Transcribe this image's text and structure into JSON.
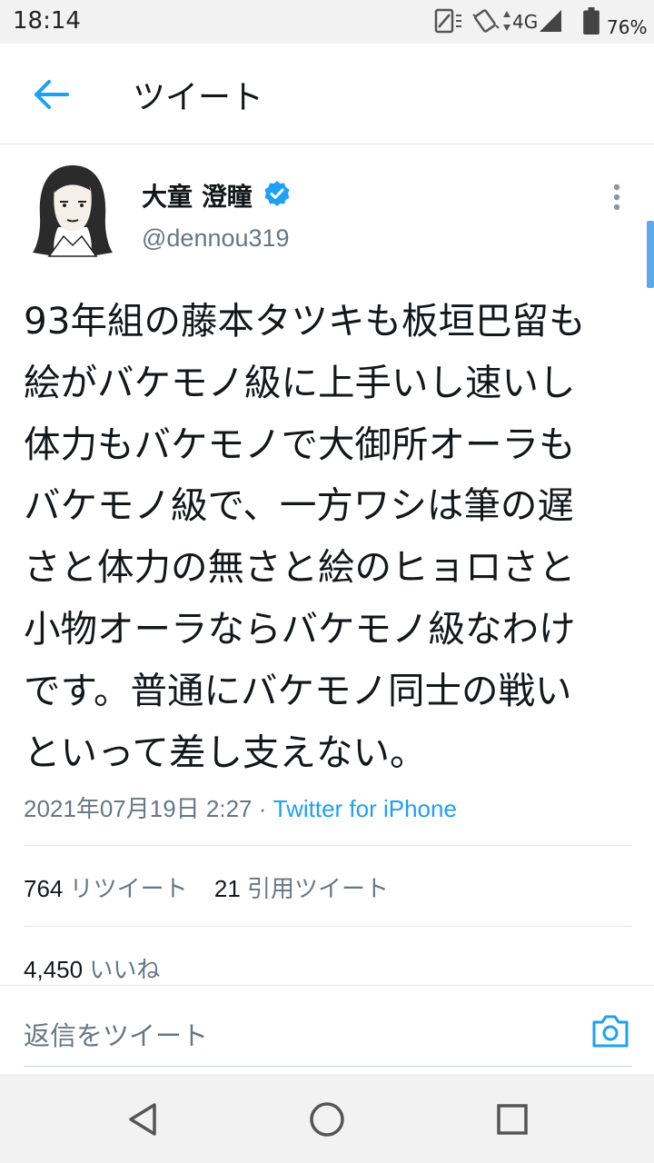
{
  "status_bar": {
    "time": "18:14",
    "network": "4G",
    "battery": "76%"
  },
  "header": {
    "title": "ツイート"
  },
  "tweet": {
    "display_name": "大童 澄瞳",
    "handle": "@dennou319",
    "verified": true,
    "text": "93年組の藤本タツキも板垣巴留も\n絵がバケモノ級に上手いし速いし\n体力もバケモノで大御所オーラも\nバケモノ級で、一方ワシは筆の遅\nさと体力の無さと絵のヒョロさと\n小物オーラならバケモノ級なわけ\nです。普通にバケモノ同士の戦い\nといって差し支えない。",
    "timestamp": "2021年07月19日 2:27",
    "separator": " · ",
    "client": "Twitter for iPhone"
  },
  "stats": {
    "retweets_count": "764",
    "retweets_label": "リツイート",
    "quotes_count": "21",
    "quotes_label": "引用ツイート",
    "likes_count": "4,450",
    "likes_label": "いいね"
  },
  "reply": {
    "placeholder": "返信をツイート"
  },
  "colors": {
    "accent": "#1da1f2",
    "secondary_text": "#657786"
  }
}
